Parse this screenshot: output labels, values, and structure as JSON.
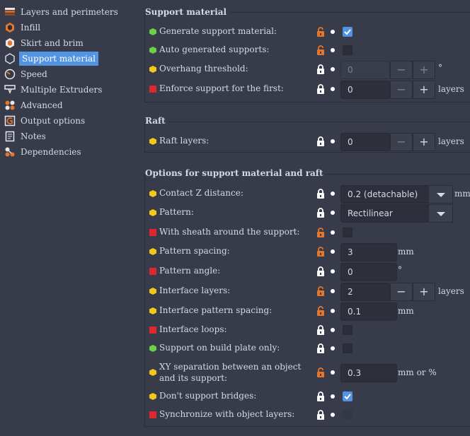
{
  "sidebar": {
    "items": [
      {
        "label": "Layers and perimeters",
        "icon": "layers-icon"
      },
      {
        "label": "Infill",
        "icon": "infill-icon"
      },
      {
        "label": "Skirt and brim",
        "icon": "skirt-icon"
      },
      {
        "label": "Support material",
        "icon": "support-icon",
        "selected": true
      },
      {
        "label": "Speed",
        "icon": "speed-icon"
      },
      {
        "label": "Multiple Extruders",
        "icon": "extruders-icon"
      },
      {
        "label": "Advanced",
        "icon": "advanced-icon"
      },
      {
        "label": "Output options",
        "icon": "output-icon"
      },
      {
        "label": "Notes",
        "icon": "notes-icon"
      },
      {
        "label": "Dependencies",
        "icon": "dependencies-icon"
      }
    ]
  },
  "groups": {
    "support": {
      "title": "Support material"
    },
    "raft": {
      "title": "Raft"
    },
    "options": {
      "title": "Options for support material and raft"
    }
  },
  "fields": {
    "generate_support": {
      "label": "Generate support material:",
      "checked": true
    },
    "auto_supports": {
      "label": "Auto generated supports:",
      "checked": false
    },
    "overhang_threshold": {
      "label": "Overhang threshold:",
      "value": "0",
      "unit": "°"
    },
    "enforce_support": {
      "label": "Enforce support for the first:",
      "value": "0",
      "unit": "layers"
    },
    "raft_layers": {
      "label": "Raft layers:",
      "value": "0",
      "unit": "layers"
    },
    "contact_z": {
      "label": "Contact Z distance:",
      "value": "0.2 (detachable)",
      "unit": "mm"
    },
    "pattern": {
      "label": "Pattern:",
      "value": "Rectilinear"
    },
    "sheath": {
      "label": "With sheath around the support:",
      "checked": false
    },
    "pattern_spacing": {
      "label": "Pattern spacing:",
      "value": "3",
      "unit": "mm"
    },
    "pattern_angle": {
      "label": "Pattern angle:",
      "value": "0",
      "unit": "°"
    },
    "interface_layers": {
      "label": "Interface layers:",
      "value": "2",
      "unit": "layers"
    },
    "interface_spacing": {
      "label": "Interface pattern spacing:",
      "value": "0.1",
      "unit": "mm"
    },
    "interface_loops": {
      "label": "Interface loops:",
      "checked": false
    },
    "build_plate_only": {
      "label": "Support on build plate only:",
      "checked": false
    },
    "xy_separation": {
      "label_line1": "XY separation between an object",
      "label_line2": "and its support:",
      "value": "0.3",
      "unit": "mm or %"
    },
    "dont_support_bridges": {
      "label": "Don't support bridges:",
      "checked": true
    },
    "sync_layers": {
      "label": "Synchronize with object layers:",
      "checked": false
    }
  },
  "controls": {
    "minus": "−",
    "plus": "+"
  },
  "colors": {
    "background": "#383c4a",
    "accent": "#5294e2",
    "lock_open": "#e5762a",
    "status_green": "#6bd045",
    "status_yellow": "#f2c81a",
    "status_red": "#e0262e"
  }
}
